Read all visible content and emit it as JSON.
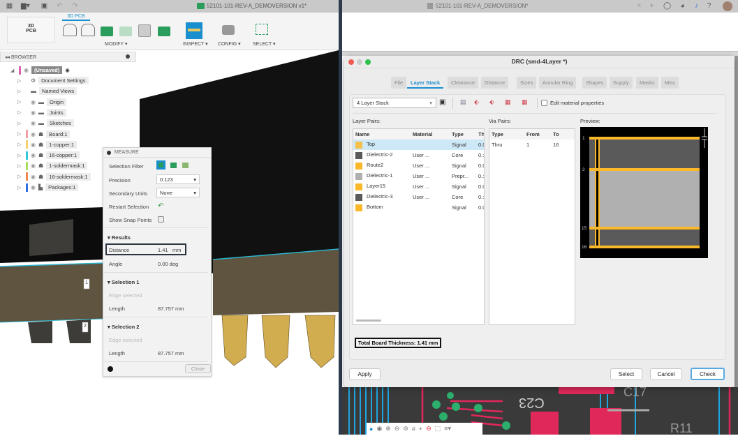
{
  "left_window": {
    "title": "52101-101-REV-A_DEMOVERSION v1*",
    "workspace": {
      "line1": "3D",
      "line2": "PCB"
    },
    "active_tab": "3D PCB",
    "toolbar_groups": [
      "MODIFY ▾",
      "INSPECT ▾",
      "CONFIG ▾",
      "SELECT ▾"
    ],
    "browser": {
      "title": "BROWSER",
      "root": "(Unsaved)",
      "items": [
        {
          "label": "Document Settings",
          "icon": "gear-icon",
          "color": ""
        },
        {
          "label": "Named Views",
          "icon": "folder-icon",
          "color": ""
        },
        {
          "label": "Origin",
          "icon": "folder-icon",
          "color": ""
        },
        {
          "label": "Joints",
          "icon": "folder-icon",
          "color": ""
        },
        {
          "label": "Sketches",
          "icon": "folder-icon",
          "color": ""
        },
        {
          "label": "Board:1",
          "icon": "body-icon",
          "color": "#f0a0a8"
        },
        {
          "label": "1-copper:1",
          "icon": "body-icon",
          "color": "#f8d070"
        },
        {
          "label": "16-copper:1",
          "icon": "body-icon",
          "color": "#30c8d8"
        },
        {
          "label": "1-soldermask:1",
          "icon": "body-icon",
          "color": "#a8e060"
        },
        {
          "label": "16-soldermask:1",
          "icon": "body-icon",
          "color": "#f08850"
        },
        {
          "label": "Packages:1",
          "icon": "component-icon",
          "color": "#3070e0"
        }
      ]
    },
    "viewport_labels": [
      "1",
      "2"
    ],
    "measure": {
      "title": "MEASURE",
      "selection_filter_label": "Selection Filter",
      "precision_label": "Precision",
      "precision_value": "0.123",
      "secondary_units_label": "Secondary Units",
      "secondary_units_value": "None",
      "restart_label": "Restart Selection",
      "snap_label": "Show Snap Points",
      "results_header": "Results",
      "distance_label": "Distance",
      "distance_value": "1.41",
      "distance_unit": "mm",
      "angle_label": "Angle",
      "angle_value": "0.00 deg",
      "selection1_header": "Selection 1",
      "selection1_edge": "Edge selected",
      "selection1_length_label": "Length",
      "selection1_length": "87.757 mm",
      "selection2_header": "Selection 2",
      "selection2_edge": "Edge selected",
      "selection2_length_label": "Length",
      "selection2_length": "87.757 mm",
      "close_label": "Close"
    }
  },
  "right_window": {
    "title": "52101-101-REV-A_DEMOVERSION*",
    "drc": {
      "title": "DRC (smd-4Layer *)",
      "tabs": [
        "File",
        "Layer Stack",
        "Clearance",
        "Distance",
        "Sizes",
        "Annular Ring",
        "Shapes",
        "Supply",
        "Masks",
        "Misc"
      ],
      "active_tab": "Layer Stack",
      "stack_select": "4 Layer Stack",
      "edit_material_label": "Edit material properties",
      "layer_pairs_label": "Layer Pairs:",
      "layer_columns": [
        "Name",
        "Material",
        "Type",
        "Th"
      ],
      "layers": [
        {
          "name": "Top",
          "material": "",
          "type": "Signal",
          "th": "0.0",
          "color": "#f5c04a",
          "selected": true
        },
        {
          "name": "Dielectric-2",
          "material": "User ...",
          "type": "Core",
          "th": "0.:",
          "color": "#5a5a5a"
        },
        {
          "name": "Route2",
          "material": "User ...",
          "type": "Signal",
          "th": "0.0",
          "color": "#fbb829"
        },
        {
          "name": "Dielectric-1",
          "material": "User ...",
          "type": "Prepr...",
          "th": "0.:",
          "color": "#b0b0b0"
        },
        {
          "name": "Layer15",
          "material": "User ...",
          "type": "Signal",
          "th": "0.0",
          "color": "#fbb829"
        },
        {
          "name": "Dielectric-3",
          "material": "User ...",
          "type": "Core",
          "th": "0.:",
          "color": "#5a5a5a"
        },
        {
          "name": "Bottom",
          "material": "",
          "type": "Signal",
          "th": "0.0",
          "color": "#fbb829"
        }
      ],
      "via_pairs_label": "Via Pairs:",
      "via_columns": [
        "Type",
        "From",
        "To"
      ],
      "vias": [
        {
          "type": "Thru",
          "from": "1",
          "to": "16"
        }
      ],
      "preview_label": "Preview:",
      "preview_layers": [
        "1",
        "2",
        "15",
        "16"
      ],
      "total_thickness": "Total Board Thickness: 1.41 mm",
      "apply_label": "Apply",
      "select_label": "Select",
      "cancel_label": "Cancel",
      "check_label": "Check"
    },
    "pcb_labels": [
      "C23",
      "C17",
      "R11"
    ]
  }
}
